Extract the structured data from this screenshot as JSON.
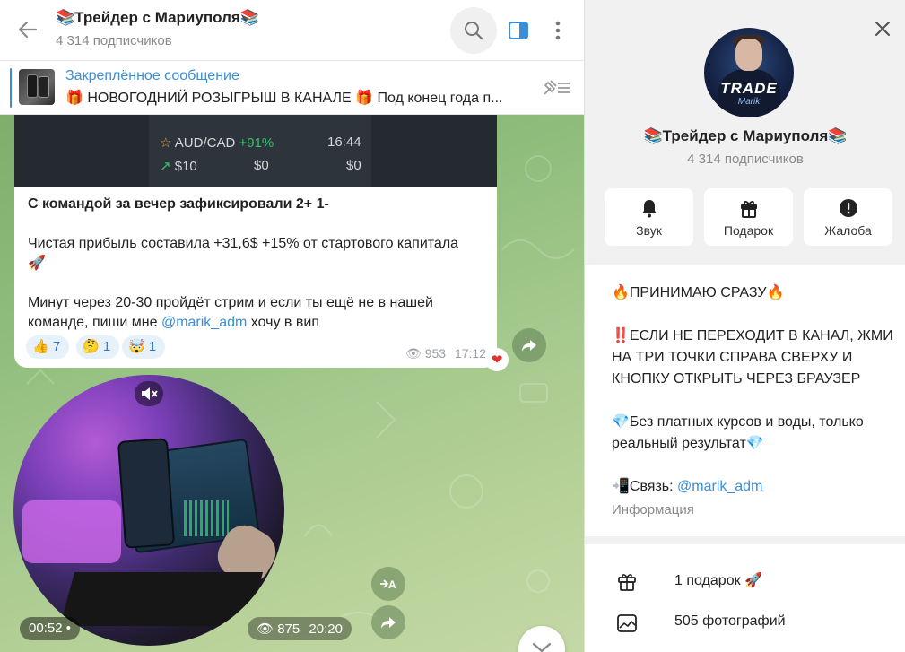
{
  "chat": {
    "title": "📚Трейдер с Мариуполя📚",
    "subscribers": "4 314 подписчиков"
  },
  "pinned": {
    "label": "Закреплённое сообщение",
    "text": "🎁 НОВОГОДНИЙ РОЗЫГРЫШ В КАНАЛЕ 🎁  Под конец года п..."
  },
  "message1": {
    "trade_rows": [
      {
        "pair": "AUD/CAD",
        "change": "+91%",
        "time": "16:44"
      },
      {
        "amount": "$10",
        "profit": "$0",
        "result": "$0"
      }
    ],
    "headline": "С командой за вечер зафиксировали 2+ 1-",
    "profit_line": "Чистая прибыль составила +31,6$ +15% от стартового капитала",
    "rocket": "🚀",
    "cta_line1": "Минут через 20-30 пройдёт стрим и если ты ещё не в нашей",
    "cta_prefix": "команде, пиши мне",
    "cta_link": "@marik_adm",
    "cta_suffix": "хочу в вип",
    "reactions": [
      {
        "emoji": "👍",
        "count": "7"
      },
      {
        "emoji": "🤔",
        "count": "1"
      },
      {
        "emoji": "🤯",
        "count": "1"
      }
    ],
    "views": "953",
    "time": "17:12",
    "reaction_badge": "❤"
  },
  "video": {
    "duration": "00:52",
    "views": "875",
    "time": "20:20"
  },
  "panel": {
    "title": "📚Трейдер с Мариуполя📚",
    "subscribers": "4 314 подписчиков",
    "avatar_text": "TRADE",
    "avatar_subtext": "Marik",
    "actions": [
      {
        "label": "Звук",
        "icon": "bell-icon"
      },
      {
        "label": "Подарок",
        "icon": "gift-icon"
      },
      {
        "label": "Жалоба",
        "icon": "warning-icon"
      }
    ],
    "about": {
      "line1": "🔥ПРИНИМАЮ СРАЗУ🔥",
      "line2": "‼️ЕСЛИ НЕ ПЕРЕХОДИТ В КАНАЛ, ЖМИ НА ТРИ ТОЧКИ СПРАВА СВЕРХУ И КНОПКУ ОТКРЫТЬ ЧЕРЕЗ БРАУЗЕР",
      "line3": "💎Без платных курсов и воды, только реальный результат💎",
      "contact_prefix": "📲Связь:",
      "contact_link": "@marik_adm",
      "label": "Информация"
    },
    "extras": [
      {
        "label": "1 подарок 🚀",
        "icon": "gift-box-icon"
      },
      {
        "label": "505 фотографий",
        "icon": "photo-icon"
      }
    ]
  },
  "colors": {
    "accent": "#3a8fd6",
    "chat_bg": "#9cc585",
    "heart": "#e0302f"
  }
}
